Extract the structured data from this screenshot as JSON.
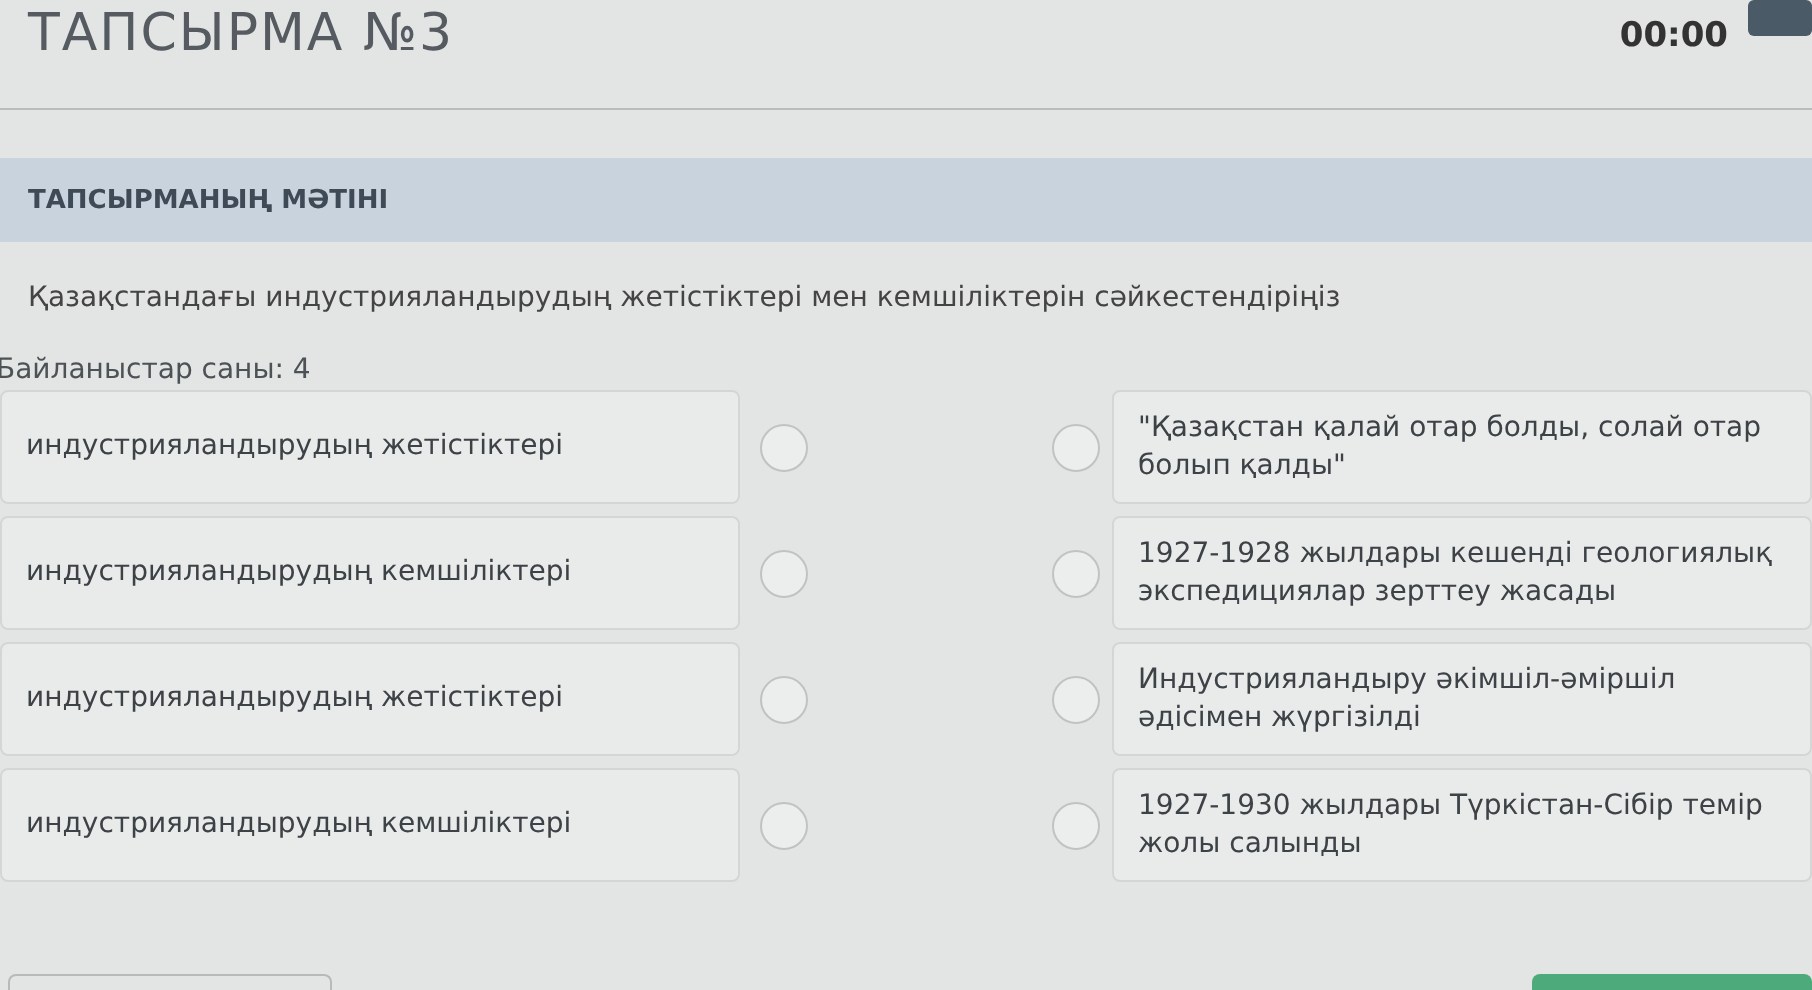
{
  "header": {
    "title": "ТАПСЫРМА №3",
    "timer": "00:00"
  },
  "section": {
    "title": "ТАПСЫРМАНЫҢ МӘТІНІ",
    "question": "Қазақстандағы индустрияландырудың жетістіктері мен кемшіліктерін сәйкестендіріңіз",
    "count": "Байланыстар саны: 4"
  },
  "pairs": [
    {
      "left": "индустрияландырудың жетістіктері",
      "left_selected": false,
      "right": "\"Қазақстан қалай отар болды, солай отар болып қалды\"",
      "right_selected": false
    },
    {
      "left": "индустрияландырудың кемшіліктері",
      "left_selected": false,
      "right": "1927-1928 жылдары кешенді геологиялық экспедициялар зерттеу жасады",
      "right_selected": false
    },
    {
      "left": "индустрияландырудың жетістіктері",
      "left_selected": false,
      "right": "Индустрияландыру әкімшіл-әміршіл әдісімен жүргізілді",
      "right_selected": false
    },
    {
      "left": "индустрияландырудың кемшіліктері",
      "left_selected": false,
      "right": "1927-1930 жылдары Түркістан-Сібір темір жолы салынды",
      "right_selected": false
    }
  ]
}
